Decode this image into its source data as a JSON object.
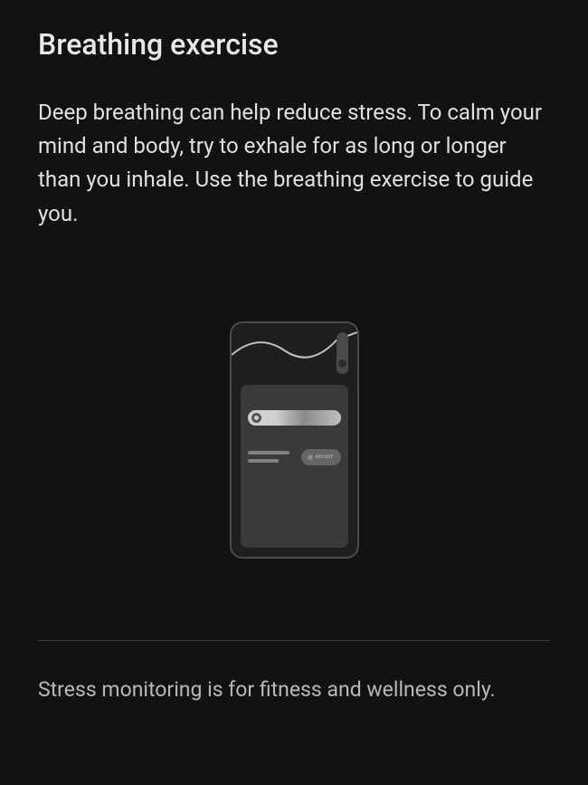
{
  "page": {
    "title": "Breathing exercise",
    "description": "Deep breathing can help reduce stress. To calm your mind and body, try to exhale for as long or longer than you inhale. Use the breathing exercise to guide you.",
    "disclaimer": "Stress monitoring is for fitness and wellness only."
  },
  "illustration": {
    "button_label": "ABCDEF"
  }
}
